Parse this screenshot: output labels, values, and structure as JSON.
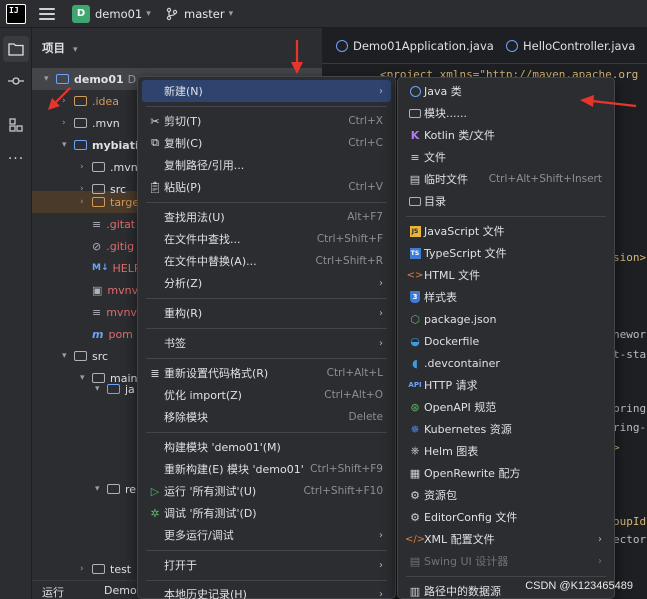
{
  "titlebar": {
    "logo_text": "IJ",
    "project_badge": "D",
    "project_name": "demo01",
    "branch_name": "master"
  },
  "project_pane": {
    "header": "项目",
    "tree": [
      {
        "label": "demo01",
        "suffix": "D",
        "type": "module",
        "level": 0,
        "expanded": true
      },
      {
        "label": ".idea",
        "type": "folder",
        "level": 1
      },
      {
        "label": ".mvn",
        "type": "folder",
        "level": 1
      },
      {
        "label": "mybiati",
        "type": "module",
        "level": 1,
        "expanded": true
      },
      {
        "label": ".mvn",
        "type": "folder",
        "level": 2
      },
      {
        "label": "src",
        "type": "folder",
        "level": 2
      },
      {
        "label": "targe",
        "type": "folder-orange",
        "level": 2
      },
      {
        "label": ".gitat",
        "type": "file-red",
        "level": 2
      },
      {
        "label": ".gitig",
        "type": "file-red",
        "level": 2
      },
      {
        "label": "HELP",
        "type": "file-red",
        "level": 2
      },
      {
        "label": "mvnv",
        "type": "file-red",
        "level": 2
      },
      {
        "label": "mvnv",
        "type": "file-red",
        "level": 2
      },
      {
        "label": "pom",
        "type": "file-red",
        "level": 2
      },
      {
        "label": "src",
        "type": "folder",
        "level": 1
      },
      {
        "label": "main",
        "type": "folder",
        "level": 2
      },
      {
        "label": "ja",
        "type": "folder-blue",
        "level": 3
      },
      {
        "label": "re",
        "type": "folder",
        "level": 3
      },
      {
        "label": "test",
        "type": "folder",
        "level": 2
      }
    ],
    "bottom_label": "运行",
    "bottom_label2": "Demo"
  },
  "editor": {
    "tabs": [
      "Demo01Application.java",
      "HelloController.java"
    ],
    "code_fragments": [
      "<project xmlns=\"http://maven.apache.org",
      "sion>",
      "nework",
      "t-sta",
      "pring",
      "ring-",
      ">",
      "oupId",
      "ector"
    ]
  },
  "context_menu": {
    "items": [
      {
        "label": "新建(N)",
        "icon": "",
        "shortcut": "",
        "submenu": true,
        "highlighted": true
      },
      {
        "label": "剪切(T)",
        "icon": "scissors-icon",
        "shortcut": "Ctrl+X"
      },
      {
        "label": "复制(C)",
        "icon": "copy-icon",
        "shortcut": "Ctrl+C"
      },
      {
        "label": "复制路径/引用...",
        "icon": "",
        "shortcut": ""
      },
      {
        "label": "粘贴(P)",
        "icon": "paste-icon",
        "shortcut": "Ctrl+V"
      },
      {
        "label": "查找用法(U)",
        "icon": "",
        "shortcut": "Alt+F7"
      },
      {
        "label": "在文件中查找...",
        "icon": "",
        "shortcut": "Ctrl+Shift+F"
      },
      {
        "label": "在文件中替换(A)...",
        "icon": "",
        "shortcut": "Ctrl+Shift+R"
      },
      {
        "label": "分析(Z)",
        "icon": "",
        "shortcut": "",
        "submenu": true
      },
      {
        "label": "重构(R)",
        "icon": "",
        "shortcut": "",
        "submenu": true
      },
      {
        "label": "书签",
        "icon": "",
        "shortcut": "",
        "submenu": true
      },
      {
        "label": "重新设置代码格式(R)",
        "icon": "format-icon",
        "shortcut": "Ctrl+Alt+L"
      },
      {
        "label": "优化 import(Z)",
        "icon": "",
        "shortcut": "Ctrl+Alt+O"
      },
      {
        "label": "移除模块",
        "icon": "",
        "shortcut": "Delete"
      },
      {
        "label": "构建模块 'demo01'(M)",
        "icon": "",
        "shortcut": ""
      },
      {
        "label": "重新构建(E) 模块 'demo01'",
        "icon": "",
        "shortcut": "Ctrl+Shift+F9"
      },
      {
        "label": "运行 '所有测试'(U)",
        "icon": "run-icon",
        "shortcut": "Ctrl+Shift+F10"
      },
      {
        "label": "调试 '所有测试'(D)",
        "icon": "debug-icon",
        "shortcut": ""
      },
      {
        "label": "更多运行/调试",
        "icon": "",
        "shortcut": "",
        "submenu": true
      },
      {
        "label": "打开于",
        "icon": "",
        "shortcut": "",
        "submenu": true
      },
      {
        "label": "本地历史记录(H)",
        "icon": "",
        "shortcut": "",
        "submenu": true
      }
    ]
  },
  "sub_menu": {
    "items": [
      {
        "label": "Java 类",
        "icon": "java-class-icon",
        "shortcut": ""
      },
      {
        "label": "模块......",
        "icon": "module-icon",
        "shortcut": ""
      },
      {
        "label": "Kotlin 类/文件",
        "icon": "kotlin-icon",
        "shortcut": ""
      },
      {
        "label": "文件",
        "icon": "file-icon",
        "shortcut": ""
      },
      {
        "label": "临时文件",
        "icon": "scratch-file-icon",
        "shortcut": "Ctrl+Alt+Shift+Insert"
      },
      {
        "label": "目录",
        "icon": "directory-icon",
        "shortcut": ""
      },
      {
        "label": "JavaScript 文件",
        "icon": "javascript-icon",
        "shortcut": ""
      },
      {
        "label": "TypeScript 文件",
        "icon": "typescript-icon",
        "shortcut": ""
      },
      {
        "label": "HTML 文件",
        "icon": "html-icon",
        "shortcut": ""
      },
      {
        "label": "样式表",
        "icon": "css-icon",
        "shortcut": ""
      },
      {
        "label": "package.json",
        "icon": "nodejs-icon",
        "shortcut": ""
      },
      {
        "label": "Dockerfile",
        "icon": "docker-icon",
        "shortcut": ""
      },
      {
        "label": ".devcontainer",
        "icon": "devcontainer-icon",
        "shortcut": ""
      },
      {
        "label": "HTTP 请求",
        "icon": "api-icon",
        "shortcut": ""
      },
      {
        "label": "OpenAPI 规范",
        "icon": "openapi-icon",
        "shortcut": ""
      },
      {
        "label": "Kubernetes 资源",
        "icon": "kubernetes-icon",
        "shortcut": ""
      },
      {
        "label": "Helm 图表",
        "icon": "helm-icon",
        "shortcut": ""
      },
      {
        "label": "OpenRewrite 配方",
        "icon": "openrewrite-icon",
        "shortcut": ""
      },
      {
        "label": "资源包",
        "icon": "resource-bundle-icon",
        "shortcut": ""
      },
      {
        "label": "EditorConfig 文件",
        "icon": "editorconfig-icon",
        "shortcut": ""
      },
      {
        "label": "XML 配置文件",
        "icon": "xml-icon",
        "shortcut": "",
        "submenu": true
      },
      {
        "label": "Swing UI 设计器",
        "icon": "swing-icon",
        "shortcut": "",
        "submenu": true,
        "disabled": true
      },
      {
        "label": "路径中的数据源",
        "icon": "datasource-icon",
        "shortcut": ""
      }
    ]
  },
  "colors": {
    "highlight": "#2e436e",
    "accent_blue": "#6da3f7",
    "red_text": "#e06c6c",
    "annotation_red": "#e8352b"
  },
  "watermark": "CSDN @K123465489"
}
